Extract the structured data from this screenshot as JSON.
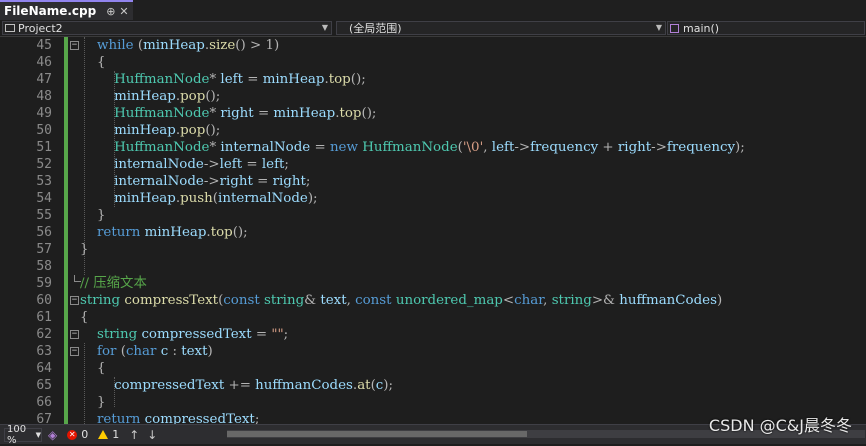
{
  "tab": {
    "title": "FileName.cpp",
    "pin": "⊕",
    "close": "✕"
  },
  "nav": {
    "project": "Project2",
    "scope": "(全局范围)",
    "member": "main()"
  },
  "line_numbers": [
    "45",
    "46",
    "47",
    "48",
    "49",
    "50",
    "51",
    "52",
    "53",
    "54",
    "55",
    "56",
    "57",
    "58",
    "59",
    "60",
    "61",
    "62",
    "63",
    "64",
    "65",
    "66",
    "67"
  ],
  "code": {
    "l45": {
      "kw": "while",
      "a": " (",
      "v1": "minHeap",
      "b": ".",
      "f1": "size",
      "c": "() > 1)"
    },
    "l46": {
      "p": "{"
    },
    "l47": {
      "t": "HuffmanNode",
      "a": "* ",
      "v1": "left",
      "b": " = ",
      "v2": "minHeap",
      "c": ".",
      "f1": "top",
      "d": "();"
    },
    "l48": {
      "v1": "minHeap",
      "a": ".",
      "f1": "pop",
      "b": "();"
    },
    "l49": {
      "t": "HuffmanNode",
      "a": "* ",
      "v1": "right",
      "b": " = ",
      "v2": "minHeap",
      "c": ".",
      "f1": "top",
      "d": "();"
    },
    "l50": {
      "v1": "minHeap",
      "a": ".",
      "f1": "pop",
      "b": "();"
    },
    "l51": {
      "t": "HuffmanNode",
      "a": "* ",
      "v1": "internalNode",
      "b": " = ",
      "kw": "new",
      "c": " ",
      "t2": "HuffmanNode",
      "d": "(",
      "s": "'\\0'",
      "e": ", ",
      "v2": "left",
      "f": "->",
      "v3": "frequency",
      "g": " + ",
      "v4": "right",
      "h": "->",
      "v5": "frequency",
      "i": ");"
    },
    "l52": {
      "v1": "internalNode",
      "a": "->",
      "v2": "left",
      "b": " = ",
      "v3": "left",
      "c": ";"
    },
    "l53": {
      "v1": "internalNode",
      "a": "->",
      "v2": "right",
      "b": " = ",
      "v3": "right",
      "c": ";"
    },
    "l54": {
      "v1": "minHeap",
      "a": ".",
      "f1": "push",
      "b": "(",
      "v2": "internalNode",
      "c": ");"
    },
    "l55": {
      "p": "}"
    },
    "l56": {
      "kw": "return",
      "a": " ",
      "v1": "minHeap",
      "b": ".",
      "f1": "top",
      "c": "();"
    },
    "l57": {
      "p": "}"
    },
    "l58": {
      "p": ""
    },
    "l59": {
      "cm": "// 压缩文本"
    },
    "l60": {
      "t": "string",
      "a": " ",
      "f1": "compressText",
      "b": "(",
      "kw1": "const",
      "c": " ",
      "t2": "string",
      "d": "& ",
      "v1": "text",
      "e": ", ",
      "kw2": "const",
      "f": " ",
      "t3": "unordered_map",
      "g": "<",
      "kw3": "char",
      "h": ", ",
      "t4": "string",
      "i": ">& ",
      "v2": "huffmanCodes",
      "j": ")"
    },
    "l61": {
      "p": "{"
    },
    "l62": {
      "t": "string",
      "a": " ",
      "v1": "compressedText",
      "b": " = ",
      "s": "\"\"",
      "c": ";"
    },
    "l63": {
      "kw": "for",
      "a": " (",
      "kw2": "char",
      "b": " ",
      "v1": "c",
      "c": " : ",
      "v2": "text",
      "d": ")"
    },
    "l64": {
      "p": "{"
    },
    "l65": {
      "v1": "compressedText",
      "a": " += ",
      "v2": "huffmanCodes",
      "b": ".",
      "f1": "at",
      "c": "(",
      "v3": "c",
      "d": ");"
    },
    "l66": {
      "p": "}"
    },
    "l67": {
      "kw": "return",
      "a": " ",
      "v1": "compressedText",
      "b": ";"
    }
  },
  "status": {
    "zoom": "100 %",
    "errors": "0",
    "warnings": "1",
    "up": "↑",
    "down": "↓"
  },
  "watermark": "CSDN @C&J晨冬冬",
  "colors": {
    "keyword": "#569cd6",
    "type": "#4ec9b0",
    "function": "#dcdcaa",
    "variable": "#9cdcfe",
    "comment": "#57a64a",
    "string": "#d69d85",
    "changebar": "#57a64a"
  }
}
